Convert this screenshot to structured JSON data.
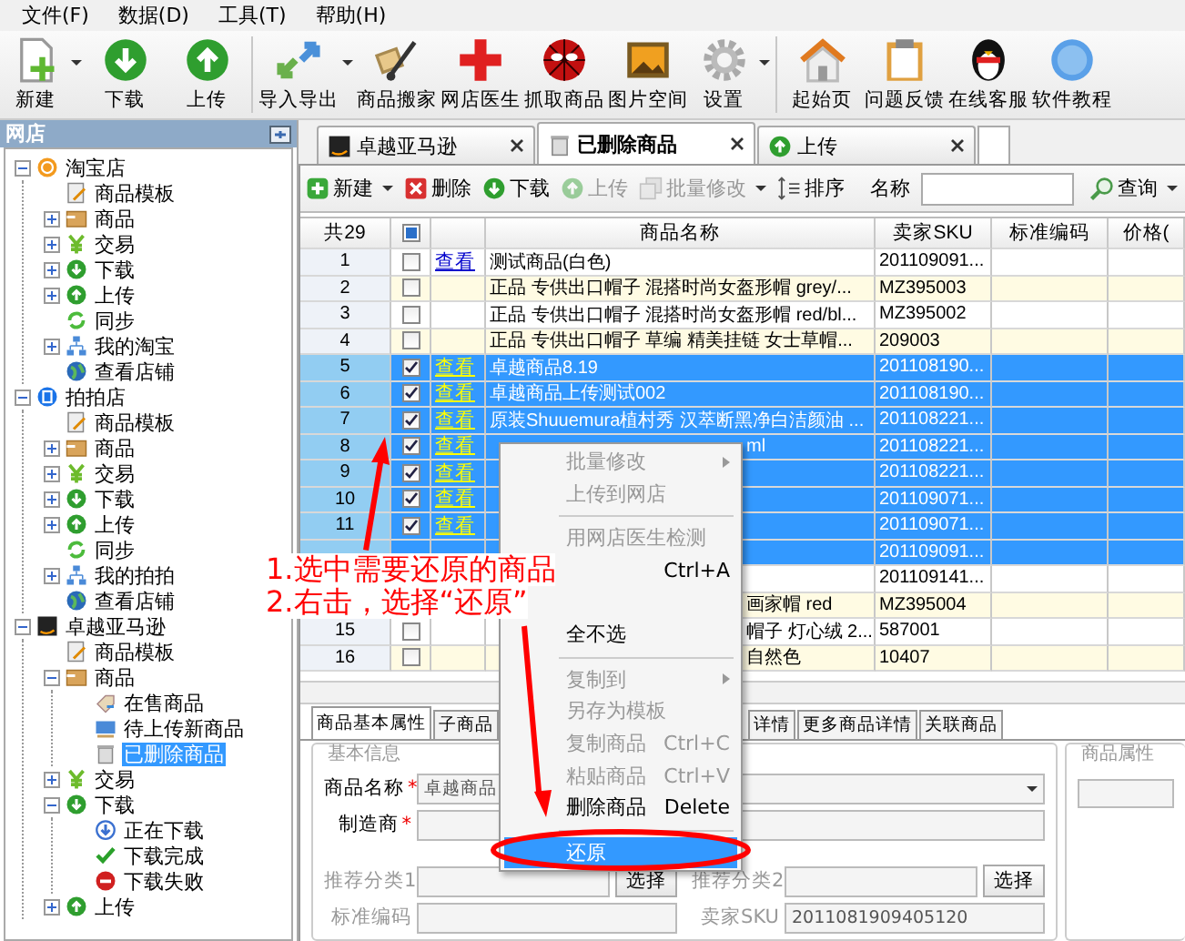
{
  "menu_bar": [
    "文件(F)",
    "数据(D)",
    "工具(T)",
    "帮助(H)"
  ],
  "toolbar": [
    {
      "kind": "new",
      "label": "新建",
      "dropdown": true
    },
    {
      "kind": "download",
      "label": "下载",
      "dropdown": false
    },
    {
      "kind": "upload",
      "label": "上传",
      "dropdown": false
    },
    {
      "kind": "separator"
    },
    {
      "kind": "import",
      "label": "导入导出",
      "dropdown": true
    },
    {
      "kind": "move",
      "label": "商品搬家",
      "dropdown": false
    },
    {
      "kind": "doctor",
      "label": "网店医生",
      "dropdown": false
    },
    {
      "kind": "grab",
      "label": "抓取商品",
      "dropdown": false
    },
    {
      "kind": "gallery",
      "label": "图片空间",
      "dropdown": false
    },
    {
      "kind": "settings",
      "label": "设置",
      "dropdown": true
    },
    {
      "kind": "separator"
    },
    {
      "kind": "home",
      "label": "起始页",
      "dropdown": false
    },
    {
      "kind": "feedback",
      "label": "问题反馈",
      "dropdown": false
    },
    {
      "kind": "service",
      "label": "在线客服",
      "dropdown": false
    },
    {
      "kind": "help",
      "label": "软件教程",
      "dropdown": false
    }
  ],
  "sidebar": {
    "title": "网店",
    "tree": [
      {
        "label": "淘宝店",
        "kind": "taobao",
        "expanded": true,
        "selected": false,
        "children": [
          {
            "label": "商品模板",
            "kind": "template",
            "selected": false
          },
          {
            "label": "商品",
            "kind": "goods",
            "expanded": false,
            "selected": false
          },
          {
            "label": "交易",
            "kind": "trade",
            "expanded": false,
            "selected": false
          },
          {
            "label": "下载",
            "kind": "download",
            "expanded": false,
            "selected": false
          },
          {
            "label": "上传",
            "kind": "upload",
            "expanded": false,
            "selected": false
          },
          {
            "label": "同步",
            "kind": "sync",
            "selected": false
          },
          {
            "label": "我的淘宝",
            "kind": "account",
            "expanded": false,
            "selected": false
          },
          {
            "label": "查看店铺",
            "kind": "store",
            "selected": false
          }
        ]
      },
      {
        "label": "拍拍店",
        "kind": "paipai",
        "expanded": true,
        "selected": false,
        "children": [
          {
            "label": "商品模板",
            "kind": "template",
            "selected": false
          },
          {
            "label": "商品",
            "kind": "goods",
            "expanded": false,
            "selected": false
          },
          {
            "label": "交易",
            "kind": "trade",
            "expanded": false,
            "selected": false
          },
          {
            "label": "下载",
            "kind": "download",
            "expanded": false,
            "selected": false
          },
          {
            "label": "上传",
            "kind": "upload",
            "expanded": false,
            "selected": false
          },
          {
            "label": "同步",
            "kind": "sync",
            "selected": false
          },
          {
            "label": "我的拍拍",
            "kind": "account",
            "expanded": false,
            "selected": false
          },
          {
            "label": "查看店铺",
            "kind": "store",
            "selected": false
          }
        ]
      },
      {
        "label": "卓越亚马逊",
        "kind": "amazon",
        "expanded": true,
        "selected": false,
        "children": [
          {
            "label": "商品模板",
            "kind": "template",
            "selected": false
          },
          {
            "label": "商品",
            "kind": "goods",
            "expanded": true,
            "selected": false,
            "children": [
              {
                "label": "在售商品",
                "kind": "on_sale",
                "selected": false
              },
              {
                "label": "待上传新商品",
                "kind": "pending",
                "selected": false
              },
              {
                "label": "已删除商品",
                "kind": "deleted",
                "selected": true
              }
            ]
          },
          {
            "label": "交易",
            "kind": "trade",
            "expanded": false,
            "selected": false
          },
          {
            "label": "下载",
            "kind": "download",
            "expanded": true,
            "selected": false,
            "children": [
              {
                "label": "正在下载",
                "kind": "downloading",
                "selected": false
              },
              {
                "label": "下载完成",
                "kind": "done",
                "selected": false
              },
              {
                "label": "下载失败",
                "kind": "failed",
                "selected": false
              }
            ]
          },
          {
            "label": "上传",
            "kind": "upload",
            "expanded": false,
            "selected": false
          }
        ]
      }
    ]
  },
  "tabs": [
    {
      "label": "卓越亚马逊",
      "kind": "amazon",
      "selected": false
    },
    {
      "label": "已删除商品",
      "kind": "deleted",
      "selected": true
    },
    {
      "label": "上传",
      "kind": "upload",
      "selected": false
    }
  ],
  "list_toolbar": {
    "buttons": [
      {
        "label": "新建",
        "kind": "add",
        "disabled": false,
        "dropdown": true
      },
      {
        "label": "删除",
        "kind": "delete",
        "disabled": false,
        "dropdown": false
      },
      {
        "label": "下载",
        "kind": "download",
        "disabled": false,
        "dropdown": false
      },
      {
        "label": "上传",
        "kind": "upload",
        "disabled": true,
        "dropdown": false
      },
      {
        "label": "批量修改",
        "kind": "batch",
        "disabled": true,
        "dropdown": true
      },
      {
        "label": "排序",
        "kind": "sort",
        "disabled": false,
        "dropdown": false
      }
    ],
    "search_label": "名称",
    "search_button": {
      "label": "查询",
      "dropdown": true
    }
  },
  "table": {
    "count": "共29",
    "select_all_partial": true,
    "columns": [
      "商品名称",
      "卖家SKU",
      "标准编码",
      "价格("
    ],
    "rows": [
      {
        "number": "1",
        "checked": false,
        "selected": false,
        "link": "查看",
        "name": "测试商品(白色)",
        "sku": "201109091..."
      },
      {
        "number": "2",
        "checked": false,
        "selected": false,
        "name": "正品 专供出口帽子 混搭时尚女盔形帽 grey/...",
        "sku": "MZ395003"
      },
      {
        "number": "3",
        "checked": false,
        "selected": false,
        "name": "正品 专供出口帽子 混搭时尚女盔形帽 red/bl...",
        "sku": "MZ395002"
      },
      {
        "number": "4",
        "checked": false,
        "selected": false,
        "name": "正品 专供出口帽子 草编 精美挂链 女士草帽...",
        "sku": "209003"
      },
      {
        "number": "5",
        "checked": true,
        "selected": true,
        "link": "查看",
        "name": "卓越商品8.19",
        "sku": "201108190..."
      },
      {
        "number": "6",
        "checked": true,
        "selected": true,
        "link": "查看",
        "name": "卓越商品上传测试002",
        "sku": "201108190..."
      },
      {
        "number": "7",
        "checked": true,
        "selected": true,
        "link": "查看",
        "name": "原装Shuuemura植村秀 汉萃断黑净白洁颜油 ...",
        "sku": "201108221..."
      },
      {
        "number": "8",
        "checked": true,
        "selected": true,
        "link": "查看",
        "name": "ml",
        "covered": true,
        "sku": "201108221..."
      },
      {
        "number": "9",
        "checked": true,
        "selected": true,
        "link": "查看",
        "sku": "201108221..."
      },
      {
        "number": "10",
        "checked": true,
        "selected": true,
        "link": "查看",
        "sku": "201109071..."
      },
      {
        "number": "11",
        "checked": true,
        "selected": true,
        "link": "查看",
        "sku": "201109071..."
      },
      {
        "selected": true,
        "sku": "201109091..."
      },
      {
        "selected": false,
        "sku": "201109141..."
      },
      {
        "selected": false,
        "name": "画家帽 red",
        "covered": true,
        "sku": "MZ395004"
      },
      {
        "number": "15",
        "checked": false,
        "selected": false,
        "name": "帽子 灯心绒 2...",
        "covered": true,
        "sku": "587001"
      },
      {
        "number": "16",
        "checked": false,
        "selected": false,
        "name": "自然色",
        "covered": true,
        "sku": "10407"
      }
    ]
  },
  "detail_tabs": [
    {
      "label": "商品基本属性",
      "selected": true
    },
    {
      "label": "子商品",
      "selected": false
    },
    {
      "label": "详情",
      "selected": false,
      "covered": true
    },
    {
      "label": "更多商品详情",
      "selected": false
    },
    {
      "label": "关联商品",
      "selected": false
    }
  ],
  "form": {
    "group_title": "基本信息",
    "rows": [
      [
        {
          "label": "商品名称",
          "required": true,
          "disabled": false,
          "value": "卓越商品",
          "dropdown": true
        }
      ],
      [
        {
          "label": "制造商",
          "required": true,
          "disabled": false
        }
      ],
      [
        {
          "label": "推荐分类1",
          "required": false,
          "disabled": true,
          "button": "选择"
        },
        {
          "label": "推荐分类2",
          "required": false,
          "disabled": true,
          "button": "选择"
        }
      ],
      [
        {
          "label": "标准编码",
          "required": false,
          "disabled": true
        },
        {
          "label": "卖家SKU",
          "required": false,
          "disabled": true,
          "value": "2011081909405120"
        }
      ]
    ],
    "side_group_title": "商品属性",
    "required_mark": "*"
  },
  "context_menu": [
    {
      "kind": "item",
      "label": "批量修改",
      "disabled": true,
      "submenu": true,
      "highlighted": false
    },
    {
      "kind": "item",
      "label": "上传到网店",
      "disabled": true,
      "submenu": false,
      "highlighted": false
    },
    {
      "kind": "separator"
    },
    {
      "kind": "item",
      "label": "用网店医生检测",
      "disabled": true,
      "submenu": false,
      "highlighted": false
    },
    {
      "kind": "item",
      "shortcut": "Ctrl+A",
      "disabled": false,
      "submenu": false,
      "highlighted": false
    },
    {
      "kind": "covered"
    },
    {
      "kind": "item",
      "label": "全不选",
      "disabled": false,
      "submenu": false,
      "highlighted": false
    },
    {
      "kind": "separator"
    },
    {
      "kind": "item",
      "label": "复制到",
      "disabled": true,
      "submenu": true,
      "highlighted": false
    },
    {
      "kind": "item",
      "label": "另存为模板",
      "disabled": true,
      "submenu": false,
      "highlighted": false
    },
    {
      "kind": "item",
      "label": "复制商品",
      "shortcut": "Ctrl+C",
      "disabled": true,
      "submenu": false,
      "highlighted": false
    },
    {
      "kind": "item",
      "label": "粘贴商品",
      "shortcut": "Ctrl+V",
      "disabled": true,
      "submenu": false,
      "highlighted": false
    },
    {
      "kind": "item",
      "label": "删除商品",
      "shortcut": "Delete",
      "disabled": false,
      "submenu": false,
      "highlighted": false
    },
    {
      "kind": "separator"
    },
    {
      "kind": "item",
      "label": "还原",
      "disabled": false,
      "submenu": false,
      "highlighted": true
    }
  ],
  "annotation": [
    "1.选中需要还原的商品",
    "2.右击，选择“还原”"
  ]
}
